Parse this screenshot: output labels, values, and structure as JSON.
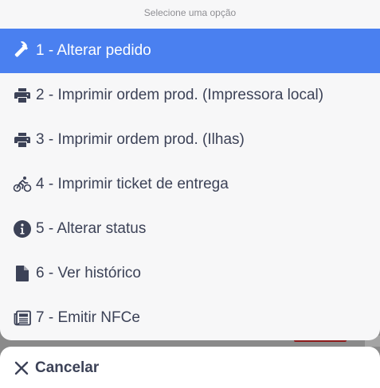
{
  "header": {
    "title": "Selecione uma opção"
  },
  "menu": {
    "items": [
      {
        "label": "1 - Alterar pedido",
        "icon": "hammer-icon",
        "active": true
      },
      {
        "label": "2 - Imprimir ordem prod. (Impressora local)",
        "icon": "printer-icon"
      },
      {
        "label": "3 - Imprimir ordem prod. (Ilhas)",
        "icon": "printer-icon"
      },
      {
        "label": "4 - Imprimir ticket de entrega",
        "icon": "bicycle-icon"
      },
      {
        "label": "5 - Alterar status",
        "icon": "info-circle-icon"
      },
      {
        "label": "6 - Ver histórico",
        "icon": "file-icon"
      },
      {
        "label": "7 - Emitir NFCe",
        "icon": "newspaper-icon"
      }
    ]
  },
  "cancel": {
    "label": "Cancelar",
    "icon": "close-icon"
  },
  "colors": {
    "accent": "#4a80f0",
    "text": "#3c4257",
    "sheet_background": "#f7f7f8",
    "backdrop": "#8a8a8a"
  }
}
